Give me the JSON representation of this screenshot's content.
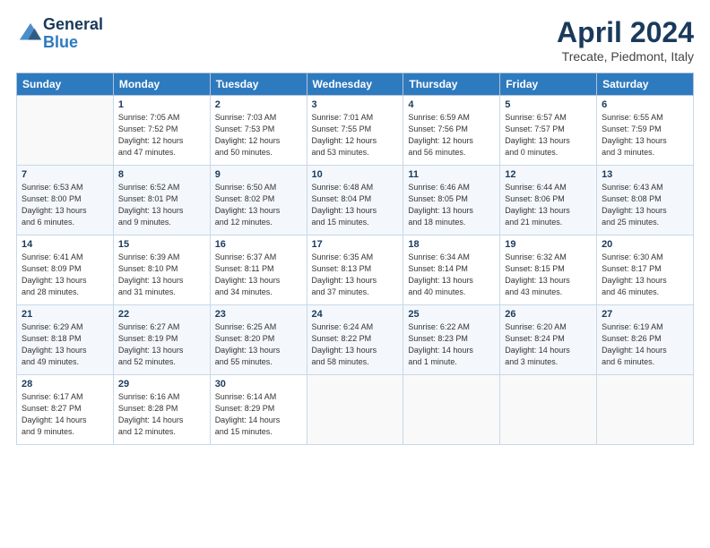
{
  "header": {
    "logo_general": "General",
    "logo_blue": "Blue",
    "title": "April 2024",
    "subtitle": "Trecate, Piedmont, Italy"
  },
  "days_of_week": [
    "Sunday",
    "Monday",
    "Tuesday",
    "Wednesday",
    "Thursday",
    "Friday",
    "Saturday"
  ],
  "weeks": [
    [
      {
        "day": "",
        "info": ""
      },
      {
        "day": "1",
        "info": "Sunrise: 7:05 AM\nSunset: 7:52 PM\nDaylight: 12 hours\nand 47 minutes."
      },
      {
        "day": "2",
        "info": "Sunrise: 7:03 AM\nSunset: 7:53 PM\nDaylight: 12 hours\nand 50 minutes."
      },
      {
        "day": "3",
        "info": "Sunrise: 7:01 AM\nSunset: 7:55 PM\nDaylight: 12 hours\nand 53 minutes."
      },
      {
        "day": "4",
        "info": "Sunrise: 6:59 AM\nSunset: 7:56 PM\nDaylight: 12 hours\nand 56 minutes."
      },
      {
        "day": "5",
        "info": "Sunrise: 6:57 AM\nSunset: 7:57 PM\nDaylight: 13 hours\nand 0 minutes."
      },
      {
        "day": "6",
        "info": "Sunrise: 6:55 AM\nSunset: 7:59 PM\nDaylight: 13 hours\nand 3 minutes."
      }
    ],
    [
      {
        "day": "7",
        "info": "Sunrise: 6:53 AM\nSunset: 8:00 PM\nDaylight: 13 hours\nand 6 minutes."
      },
      {
        "day": "8",
        "info": "Sunrise: 6:52 AM\nSunset: 8:01 PM\nDaylight: 13 hours\nand 9 minutes."
      },
      {
        "day": "9",
        "info": "Sunrise: 6:50 AM\nSunset: 8:02 PM\nDaylight: 13 hours\nand 12 minutes."
      },
      {
        "day": "10",
        "info": "Sunrise: 6:48 AM\nSunset: 8:04 PM\nDaylight: 13 hours\nand 15 minutes."
      },
      {
        "day": "11",
        "info": "Sunrise: 6:46 AM\nSunset: 8:05 PM\nDaylight: 13 hours\nand 18 minutes."
      },
      {
        "day": "12",
        "info": "Sunrise: 6:44 AM\nSunset: 8:06 PM\nDaylight: 13 hours\nand 21 minutes."
      },
      {
        "day": "13",
        "info": "Sunrise: 6:43 AM\nSunset: 8:08 PM\nDaylight: 13 hours\nand 25 minutes."
      }
    ],
    [
      {
        "day": "14",
        "info": "Sunrise: 6:41 AM\nSunset: 8:09 PM\nDaylight: 13 hours\nand 28 minutes."
      },
      {
        "day": "15",
        "info": "Sunrise: 6:39 AM\nSunset: 8:10 PM\nDaylight: 13 hours\nand 31 minutes."
      },
      {
        "day": "16",
        "info": "Sunrise: 6:37 AM\nSunset: 8:11 PM\nDaylight: 13 hours\nand 34 minutes."
      },
      {
        "day": "17",
        "info": "Sunrise: 6:35 AM\nSunset: 8:13 PM\nDaylight: 13 hours\nand 37 minutes."
      },
      {
        "day": "18",
        "info": "Sunrise: 6:34 AM\nSunset: 8:14 PM\nDaylight: 13 hours\nand 40 minutes."
      },
      {
        "day": "19",
        "info": "Sunrise: 6:32 AM\nSunset: 8:15 PM\nDaylight: 13 hours\nand 43 minutes."
      },
      {
        "day": "20",
        "info": "Sunrise: 6:30 AM\nSunset: 8:17 PM\nDaylight: 13 hours\nand 46 minutes."
      }
    ],
    [
      {
        "day": "21",
        "info": "Sunrise: 6:29 AM\nSunset: 8:18 PM\nDaylight: 13 hours\nand 49 minutes."
      },
      {
        "day": "22",
        "info": "Sunrise: 6:27 AM\nSunset: 8:19 PM\nDaylight: 13 hours\nand 52 minutes."
      },
      {
        "day": "23",
        "info": "Sunrise: 6:25 AM\nSunset: 8:20 PM\nDaylight: 13 hours\nand 55 minutes."
      },
      {
        "day": "24",
        "info": "Sunrise: 6:24 AM\nSunset: 8:22 PM\nDaylight: 13 hours\nand 58 minutes."
      },
      {
        "day": "25",
        "info": "Sunrise: 6:22 AM\nSunset: 8:23 PM\nDaylight: 14 hours\nand 1 minute."
      },
      {
        "day": "26",
        "info": "Sunrise: 6:20 AM\nSunset: 8:24 PM\nDaylight: 14 hours\nand 3 minutes."
      },
      {
        "day": "27",
        "info": "Sunrise: 6:19 AM\nSunset: 8:26 PM\nDaylight: 14 hours\nand 6 minutes."
      }
    ],
    [
      {
        "day": "28",
        "info": "Sunrise: 6:17 AM\nSunset: 8:27 PM\nDaylight: 14 hours\nand 9 minutes."
      },
      {
        "day": "29",
        "info": "Sunrise: 6:16 AM\nSunset: 8:28 PM\nDaylight: 14 hours\nand 12 minutes."
      },
      {
        "day": "30",
        "info": "Sunrise: 6:14 AM\nSunset: 8:29 PM\nDaylight: 14 hours\nand 15 minutes."
      },
      {
        "day": "",
        "info": ""
      },
      {
        "day": "",
        "info": ""
      },
      {
        "day": "",
        "info": ""
      },
      {
        "day": "",
        "info": ""
      }
    ]
  ]
}
